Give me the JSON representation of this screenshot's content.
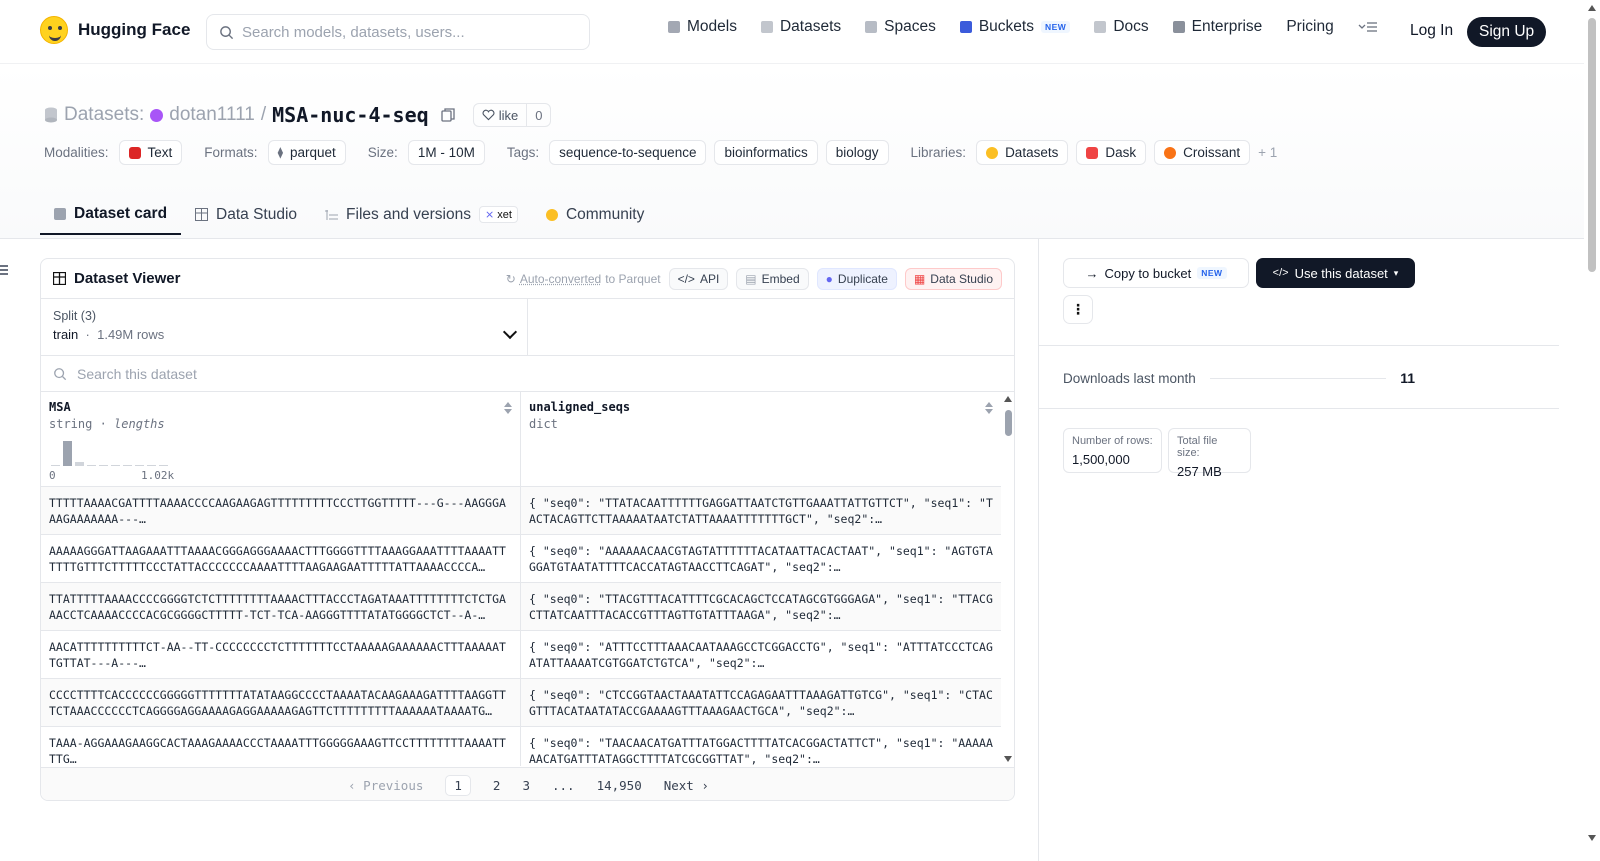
{
  "nav": {
    "logo_text": "Hugging Face",
    "search_placeholder": "Search models, datasets, users...",
    "links": [
      {
        "label": "Models",
        "icon": "cube-icon"
      },
      {
        "label": "Datasets",
        "icon": "database-icon"
      },
      {
        "label": "Spaces",
        "icon": "grid-icon"
      },
      {
        "label": "Buckets",
        "icon": "bucket-icon",
        "badge": "NEW"
      },
      {
        "label": "Docs",
        "icon": "book-icon"
      },
      {
        "label": "Enterprise",
        "icon": "enterprise-icon"
      },
      {
        "label": "Pricing"
      }
    ],
    "login": "Log In",
    "signup": "Sign Up"
  },
  "header": {
    "section": "Datasets:",
    "org": "dotan1111",
    "separator": "/",
    "repo": "MSA-nuc-4-seq",
    "like_label": "like",
    "like_count": "0",
    "modalities_label": "Modalities:",
    "modalities": [
      "Text"
    ],
    "formats_label": "Formats:",
    "formats": [
      "parquet"
    ],
    "size_label": "Size:",
    "size": "1M - 10M",
    "tags_label": "Tags:",
    "tags": [
      "sequence-to-sequence",
      "bioinformatics",
      "biology"
    ],
    "libraries_label": "Libraries:",
    "libraries": [
      "Datasets",
      "Dask",
      "Croissant"
    ],
    "libraries_more": "+ 1"
  },
  "tabs": [
    {
      "label": "Dataset card",
      "active": true
    },
    {
      "label": "Data Studio"
    },
    {
      "label": "Files and versions",
      "badge": "xet"
    },
    {
      "label": "Community"
    }
  ],
  "viewer": {
    "title": "Dataset Viewer",
    "auto_converted_link": "Auto-converted",
    "auto_converted_suffix": "to Parquet",
    "api": "API",
    "embed": "Embed",
    "duplicate": "Duplicate",
    "data_studio": "Data Studio",
    "split_label": "Split (3)",
    "split_value": "train",
    "split_rows": "1.49M rows",
    "search_placeholder": "Search this dataset",
    "columns": [
      {
        "name": "MSA",
        "type": "string",
        "type_extra": "lengths",
        "hist_min": "0",
        "hist_max": "1.02k",
        "hist_levels": [
          0.05,
          0.95,
          0.15,
          0.05,
          0.05,
          0.05,
          0.05,
          0.05,
          0.05,
          0.05
        ]
      },
      {
        "name": "unaligned_seqs",
        "type": "dict"
      }
    ],
    "rows": [
      [
        "TTTTTAAAACGATTTTAAAACCCCAAGAAGAGTTTTTTTTTCCCTTGGTTTTT---G---AAGGGAAAGAAAAAAA---…",
        "{ \"seq0\": \"TTATACAATTTTTTGAGGATTAATCTGTTGAAATTATTGTTCT\", \"seq1\": \"TACTACAGTTCTTAAAAATAATCTATTAAAATTTTTTTGCT\", \"seq2\":…"
      ],
      [
        "AAAAAGGGATTAAGAAATTTAAAACGGGAGGGAAAACTTTGGGGTTTTAAAGGAAATTTTAAAATTTTTTGTTTCTTTTTCCCTATTACCCCCCCAAAATTTTAAGAAGAATTTTTATTAAAACCCCA…",
        "{ \"seq0\": \"AAAAAACAACGTAGTATTTTTTACATAATTACACTAAT\", \"seq1\": \"AGTGTAGGATGTAATATTTTCACCATAGTAACCTTCAGAT\", \"seq2\":…"
      ],
      [
        "TTATTTTTAAAACCCCGGGGTCTCTTTTTTTTAAAACTTTACCCTAGATAAATTTTTTTTCTCTGAAACCTCAAAACCCCACGCGGGGCTTTTT-TCT-TCA-AAGGGTTTTATATGGGGCTCT--A-…",
        "{ \"seq0\": \"TTACGTTTACATTTTCGCACAGCTCCATAGCGTGGGAGA\", \"seq1\": \"TTACGCTTATCAATTTACACCGTTTAGTTGTATTTAAGA\", \"seq2\":…"
      ],
      [
        "AACATTTTTTTTTTCT-AA--TT-CCCCCCCCTCTTTTTTTCCTAAAAAGAAAAAACTTTAAAAATTGTTAT---A---…",
        "{ \"seq0\": \"ATTTCCTTTAAACAATAAAGCCTCGGACCTG\", \"seq1\": \"ATTTATCCCTCAGATATTAAAATCGTGGATCTGTCA\", \"seq2\":…"
      ],
      [
        "CCCCTTTTCACCCCCCGGGGGTTTTTTTATATAAGGCCCCTAAAATACAAGAAAGATTTTAAGGTTTCTAAACCCCCCTCAGGGGAGGAAAAGAGGAAAAAGAGTTCTTTTTTTTTAAAAAATAAAATG…",
        "{ \"seq0\": \"CTCCGGTAACTAAATATTCCAGAGAATTTAAAGATTGTCG\", \"seq1\": \"CTACGTTTACATAATATACCGAAAAGTTTAAAGAACTGCA\", \"seq2\":…"
      ],
      [
        "TAAA-AGGAAAGAAGGCACTAAAGAAAACCCTAAAATTTGGGGGAAAGTTCCTTTTTTTTAAAATTTTG…",
        "{ \"seq0\": \"TAACAACATGATTTATGGACTTTTATCACGGACTATTCT\", \"seq1\": \"AAAAAAACATGATTTATAGGCTTTTATCGCGGTTAT\", \"seq2\":…"
      ]
    ],
    "pager": {
      "previous": "Previous",
      "pages": [
        "1",
        "2",
        "3",
        "...",
        "14,950"
      ],
      "next": "Next"
    }
  },
  "sidebar": {
    "copy_to_bucket": "Copy to bucket",
    "copy_badge": "NEW",
    "use_dataset": "Use this dataset",
    "more": "⋮",
    "downloads_label": "Downloads last month",
    "downloads_value": "11",
    "rows_label": "Number of rows:",
    "rows_value": "1,500,000",
    "size_label": "Total file size:",
    "size_value": "257 MB"
  }
}
